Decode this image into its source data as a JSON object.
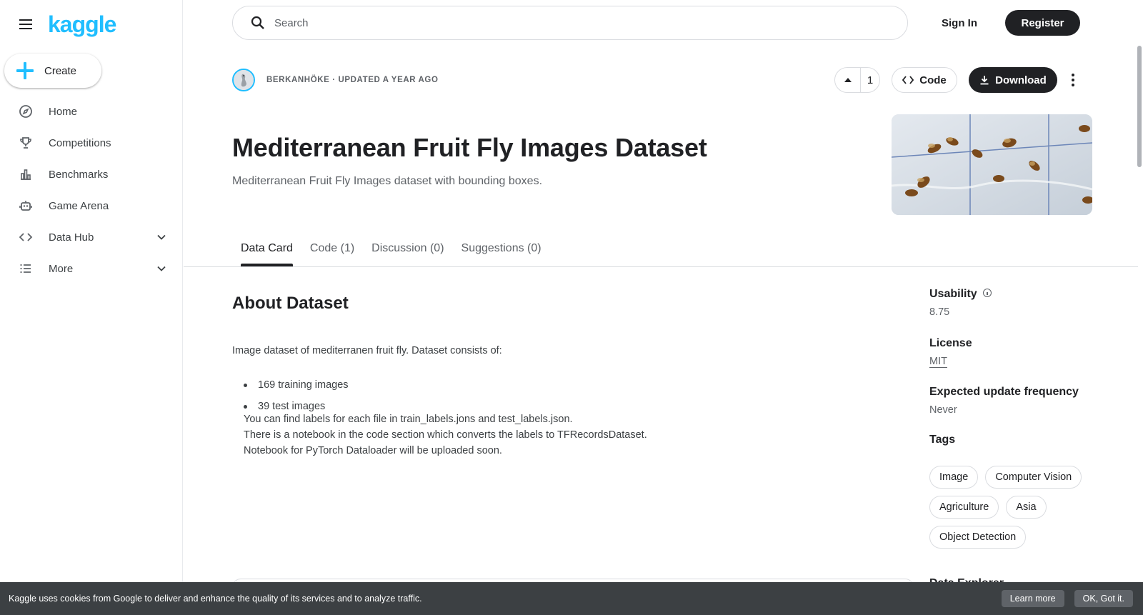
{
  "brand": {
    "logo_text": "kaggle",
    "accent": "#20beff"
  },
  "sidebar": {
    "create_label": "Create",
    "items": [
      {
        "label": "Home",
        "icon": "compass-icon"
      },
      {
        "label": "Competitions",
        "icon": "trophy-icon"
      },
      {
        "label": "Benchmarks",
        "icon": "bar-chart-icon"
      },
      {
        "label": "Game Arena",
        "icon": "robot-icon"
      },
      {
        "label": "Data Hub",
        "icon": "code-brackets-icon",
        "expandable": true
      },
      {
        "label": "More",
        "icon": "list-icon",
        "expandable": true
      }
    ]
  },
  "topbar": {
    "search_placeholder": "Search",
    "signin_label": "Sign In",
    "register_label": "Register"
  },
  "dataset": {
    "author_line": "BERKANHÖKE · UPDATED A YEAR AGO",
    "upvotes": "1",
    "code_label": "Code",
    "download_label": "Download",
    "title": "Mediterranean Fruit Fly Images Dataset",
    "subtitle": "Mediterranean Fruit Fly Images dataset with bounding boxes."
  },
  "tabs": [
    {
      "label": "Data Card",
      "active": true
    },
    {
      "label": "Code (1)"
    },
    {
      "label": "Discussion (0)"
    },
    {
      "label": "Suggestions (0)"
    }
  ],
  "about": {
    "heading": "About Dataset",
    "intro": "Image dataset of mediterranen fruit fly. Dataset consists of:",
    "bullets": [
      "169 training images",
      "39 test images"
    ],
    "lines": [
      "You can find labels for each file in train_labels.jons and test_labels.json.",
      "There is a notebook in the code section which converts the labels to TFRecordsDataset.",
      "Notebook for PyTorch Dataloader will be uploaded soon."
    ]
  },
  "meta": {
    "usability_label": "Usability",
    "usability_value": "8.75",
    "license_label": "License",
    "license_value": "MIT",
    "frequency_label": "Expected update frequency",
    "frequency_value": "Never",
    "tags_label": "Tags",
    "tags": [
      "Image",
      "Computer Vision",
      "Agriculture",
      "Asia",
      "Object Detection"
    ],
    "next_heading_partial": "Data Explorer"
  },
  "cookie": {
    "text": "Kaggle uses cookies from Google to deliver and enhance the quality of its services and to analyze traffic.",
    "learn_more": "Learn more",
    "ok": "OK, Got it."
  }
}
